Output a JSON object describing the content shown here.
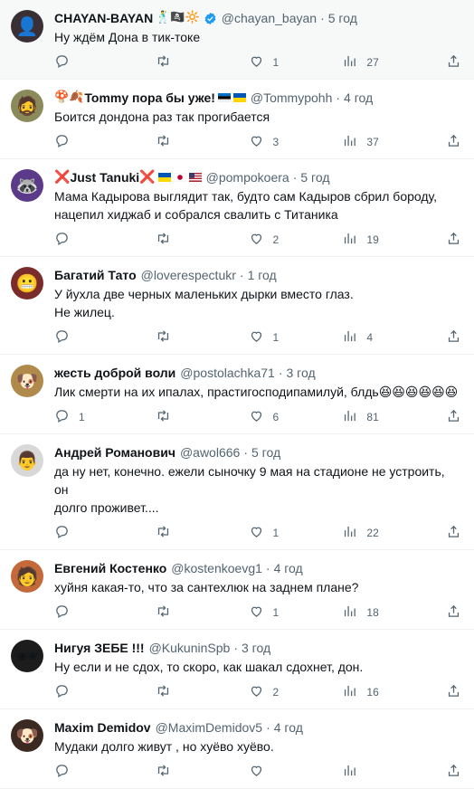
{
  "tweets": [
    {
      "name": "CHAYAN-BAYAN",
      "name_emoji": "🕺🏴‍☠️🔆",
      "verified": true,
      "handle": "@chayan_bayan",
      "time": "5 год",
      "text": "Ну ждём Дона в тик-токе",
      "replies": "",
      "retweets": "",
      "likes": "1",
      "views": "27",
      "avatar_bg": "#3a2f35",
      "avatar_glyph": "👤"
    },
    {
      "name_prefix_emoji": "🍄🍂",
      "name": "Tommy пора бы уже!",
      "flags": [
        "ee",
        "ua"
      ],
      "handle": "@Tommypohh",
      "time": "4 год",
      "text": "Боится дондона раз так прогибается",
      "replies": "",
      "retweets": "",
      "likes": "3",
      "views": "37",
      "avatar_bg": "#8a8a5a",
      "avatar_glyph": "🧔"
    },
    {
      "name_prefix": "❌",
      "name": "Just Tanuki",
      "name_suffix": "❌",
      "flags": [
        "ua",
        "jp",
        "us"
      ],
      "handle": "@pompokoera",
      "time": "5 год",
      "text": "Мама Кадырова выглядит так, будто сам Кадыров сбрил бороду,\nнацепил хиджаб и собрался свалить с Титаника",
      "replies": "",
      "retweets": "",
      "likes": "2",
      "views": "19",
      "avatar_bg": "#5b3a8a",
      "avatar_glyph": "🦝"
    },
    {
      "name": "Багатий Тато",
      "handle": "@loverespectukr",
      "time": "1 год",
      "text": "У йухла две черных маленьких дырки вместо глаз.\nНе жилец.",
      "replies": "",
      "retweets": "",
      "likes": "1",
      "views": "4",
      "avatar_bg": "#7a2b2b",
      "avatar_glyph": "😬"
    },
    {
      "name": "жесть доброй воли",
      "handle": "@postolachka71",
      "time": "3 год",
      "text": "Лик смерти на их ипалах, прастигосподипамилуй, блдь😆😆😆😆😆😆",
      "replies": "1",
      "retweets": "",
      "likes": "6",
      "views": "81",
      "avatar_bg": "#b08a4a",
      "avatar_glyph": "🐶"
    },
    {
      "name": "Андрей Романович",
      "handle": "@awol666",
      "time": "5 год",
      "text": "да ну нет, конечно. ежели сыночку 9 мая на стадионе не устроить, он\nдолго проживет....",
      "replies": "",
      "retweets": "",
      "likes": "1",
      "views": "22",
      "avatar_bg": "#d8d8d8",
      "avatar_glyph": "👨"
    },
    {
      "name": "Евгений Костенко",
      "handle": "@kostenkoevg1",
      "time": "4 год",
      "text": "хуйня какая-то, что за сантехлюк на заднем плане?",
      "replies": "",
      "retweets": "",
      "likes": "1",
      "views": "18",
      "avatar_bg": "#c46a3a",
      "avatar_glyph": "🧑"
    },
    {
      "name": "Нигуя ЗЕБЕ !!!",
      "handle": "@KukuninSpb",
      "time": "3 год",
      "text": "Ну если и не сдох, то скоро, как шакал сдохнет, дон.",
      "replies": "",
      "retweets": "",
      "likes": "2",
      "views": "16",
      "avatar_bg": "#1c1c1c",
      "avatar_glyph": "🕶"
    },
    {
      "name": "Maxim Demidov",
      "handle": "@MaximDemidov5",
      "time": "4 год",
      "text": "Мудаки долго живут , но хуёво хуёво.",
      "replies": "",
      "retweets": "",
      "likes": "",
      "views": "",
      "avatar_bg": "#3a2a22",
      "avatar_glyph": "🐶"
    }
  ],
  "colors": {
    "secondary_text": "#536471",
    "verified_blue": "#1d9bf0",
    "divider": "#eff3f4"
  },
  "icons": [
    "reply-icon",
    "retweet-icon",
    "like-icon",
    "views-icon",
    "share-icon",
    "verified-badge-icon"
  ]
}
